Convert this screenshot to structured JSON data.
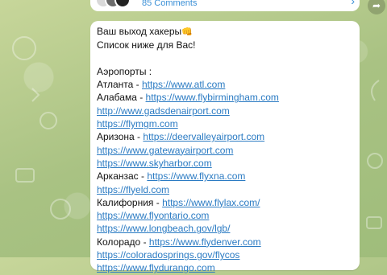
{
  "comments": {
    "count_label": "85 Comments"
  },
  "post": {
    "greeting": "Ваш выход хакеры",
    "greeting_emoji": "👊",
    "subtitle": "Список ниже для Вас!",
    "section_title": "Аэропорты :",
    "lines": [
      {
        "label": "Атланта - ",
        "link": "https://www.atl.com"
      },
      {
        "label": "Алабама - ",
        "link": "https://www.flybirmingham.com"
      },
      {
        "label": "",
        "link": "http://www.gadsdenairport.com"
      },
      {
        "label": "",
        "link": "https://flymgm.com"
      },
      {
        "label": "Аризона - ",
        "link": "https://deervalleyairport.com"
      },
      {
        "label": "",
        "link": "https://www.gatewayairport.com"
      },
      {
        "label": "",
        "link": "https://www.skyharbor.com"
      },
      {
        "label": "Арканзас - ",
        "link": "https://www.flyxna.com"
      },
      {
        "label": "",
        "link": "https://flyeld.com"
      },
      {
        "label": "Калифорния - ",
        "link": "https://www.flylax.com/"
      },
      {
        "label": "",
        "link": "https://www.flyontario.com"
      },
      {
        "label": "",
        "link": "https://www.longbeach.gov/lgb/"
      },
      {
        "label": "Колорадо - ",
        "link": "https://www.flydenver.com"
      },
      {
        "label": "",
        "link": "https://coloradosprings.gov/flycos"
      },
      {
        "label": "",
        "link": "https://www.flydurango.com"
      }
    ]
  }
}
